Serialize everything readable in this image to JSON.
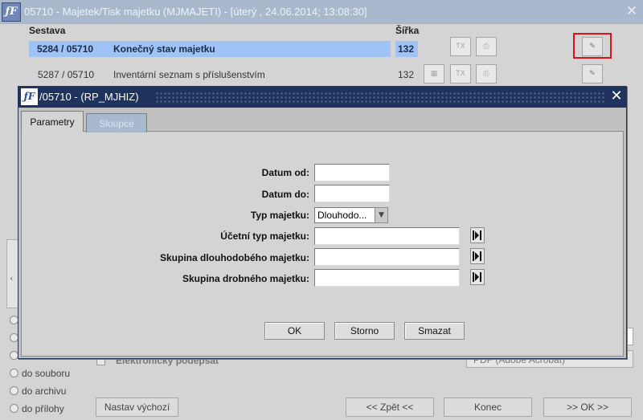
{
  "main_window": {
    "title": "05710 - Majetek/Tisk majetku (MJMAJETI) - [úterý  , 24.06.2014; 13:08:30]",
    "headers": {
      "report": "Sestava",
      "width": "Šířka"
    },
    "rows": [
      {
        "code": "5284 / 05710",
        "name": "Konečný stav majetku",
        "width": "132",
        "selected": true
      },
      {
        "code": "5287 / 05710",
        "name": "Inventární seznam s příslušenstvím",
        "width": "132",
        "selected": false
      }
    ],
    "options_radios": [
      "do souboru",
      "do archivu",
      "do přílohy"
    ],
    "signature_label": "Elektronický podepsat",
    "format_value": "PDF (Adobe Acrobat)",
    "buttons": {
      "set_default": "Nastav výchozí",
      "back": "<< Zpět <<",
      "end": "Konec",
      "ok": ">> OK >>"
    }
  },
  "dialog": {
    "title": "/05710 - (RP_MJHIZ)",
    "tabs": [
      "Parametry",
      "Sloupce"
    ],
    "fields": {
      "date_from": {
        "label": "Datum od:",
        "value": ""
      },
      "date_to": {
        "label": "Datum do:",
        "value": ""
      },
      "asset_type": {
        "label": "Typ majetku:",
        "value": "Dlouhodo..."
      },
      "accounting_type": {
        "label": "Účetní typ majetku:",
        "value": ""
      },
      "long_term_group": {
        "label": "Skupina dlouhodobého majetku:",
        "value": ""
      },
      "small_group": {
        "label": "Skupina drobného majetku:",
        "value": ""
      }
    },
    "buttons": {
      "ok": "OK",
      "cancel": "Storno",
      "clear": "Smazat"
    }
  },
  "colors": {
    "dialog_title": "#20335e",
    "selection": "#9ec3f4",
    "highlight_box": "#d9141a"
  }
}
